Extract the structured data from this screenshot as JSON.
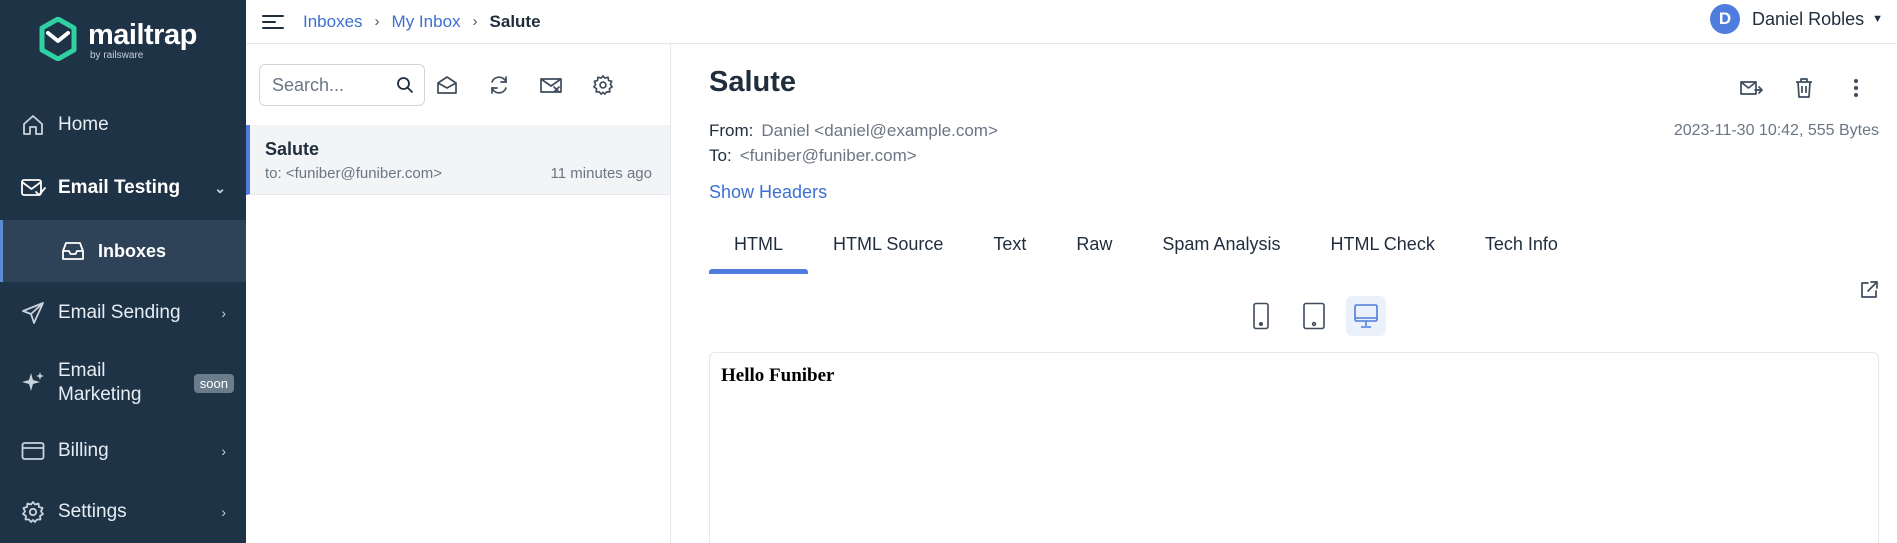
{
  "brand": {
    "name": "mailtrap",
    "sub": "by railsware",
    "logo_color": "#2fd1a3"
  },
  "sidebar": {
    "home": "Home",
    "email_testing": "Email Testing",
    "inboxes": "Inboxes",
    "email_sending": "Email Sending",
    "email_marketing_l1": "Email",
    "email_marketing_l2": "Marketing",
    "soon": "soon",
    "billing": "Billing",
    "settings": "Settings"
  },
  "breadcrumb": {
    "inboxes": "Inboxes",
    "my_inbox": "My Inbox",
    "current": "Salute"
  },
  "user": {
    "initial": "D",
    "name": "Daniel Robles"
  },
  "search": {
    "placeholder": "Search..."
  },
  "message": {
    "subject": "Salute",
    "to": "to: <funiber@funiber.com>",
    "time": "11 minutes ago"
  },
  "email": {
    "subject": "Salute",
    "from_label": "From:",
    "from_value": "Daniel <daniel@example.com>",
    "to_label": "To:",
    "to_value": "<funiber@funiber.com>",
    "meta": "2023-11-30 10:42, 555 Bytes",
    "show_headers": "Show Headers",
    "body": "Hello Funiber"
  },
  "tabs": [
    "HTML",
    "HTML Source",
    "Text",
    "Raw",
    "Spam Analysis",
    "HTML Check",
    "Tech Info"
  ],
  "colors": {
    "sidebar_bg": "#1f3347",
    "accent": "#4f7cdd",
    "link": "#3c6fd1"
  }
}
